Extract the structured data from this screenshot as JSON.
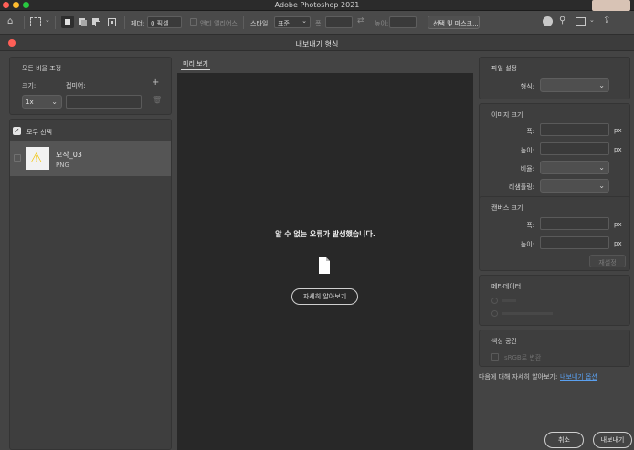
{
  "mac": {
    "title": "Adobe Photoshop 2021"
  },
  "optionsbar": {
    "feather_label": "페더:",
    "feather_value": "0 픽셀",
    "antialias": "앤티 앨리어스",
    "style_label": "스타일:",
    "style_value": "표준",
    "width_label": "폭:",
    "height_label": "높이:",
    "select_mask": "선택 및 마스크..."
  },
  "dialog": {
    "title": "내보내기 형식"
  },
  "left": {
    "scale_all": "모든 비율 조정",
    "size_label": "크기:",
    "suffix_label": "접미어:",
    "add": "+",
    "scale_value": "1x",
    "select_all": "모두 선택",
    "asset_name": "모작_03",
    "asset_format": "PNG"
  },
  "preview": {
    "tab": "미리 보기",
    "error": "알 수 없는 오류가 발생했습니다.",
    "learn_more": "자세히 알아보기"
  },
  "right": {
    "file_settings": "파일 설정",
    "format_label": "형식:",
    "image_size": "이미지 크기",
    "width_label": "폭:",
    "height_label": "높이:",
    "px": "px",
    "scale_label": "비율:",
    "resample_label": "리샘플링:",
    "canvas_size": "캔버스 크기",
    "canvas_width_label": "폭:",
    "canvas_height_label": "높이:",
    "reset": "재설정",
    "metadata": "메타데이터",
    "color_space": "색상 공간",
    "srgb": "sRGB로 변환",
    "learn_prefix": "다음에 대해 자세히 알아보기:",
    "learn_link": "내보내기 옵션"
  },
  "footer": {
    "cancel": "취소",
    "export": "내보내기"
  }
}
